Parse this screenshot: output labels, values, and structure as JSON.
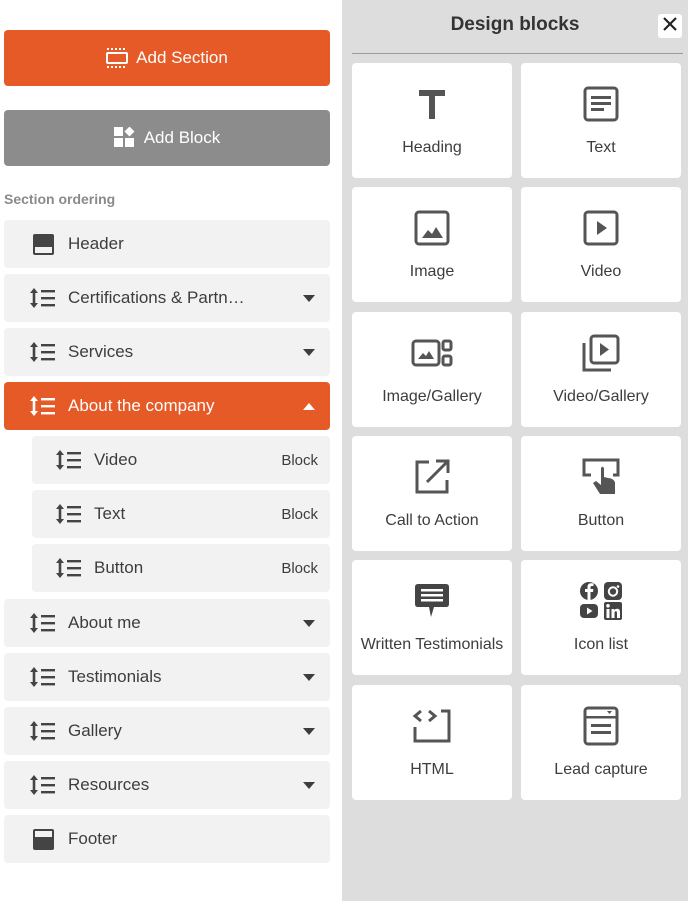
{
  "colors": {
    "accent": "#e55a26",
    "secondary_button": "#8c8c8c",
    "row_bg": "#f2f2f2",
    "icon": "#444444",
    "panel_bg": "#dddddd"
  },
  "left": {
    "add_section_label": "Add Section",
    "add_block_label": "Add Block",
    "section_ordering_label": "Section ordering",
    "rows": [
      {
        "label": "Header",
        "icon": "header-layout-icon",
        "kind": "fixed"
      },
      {
        "label": "Certifications & Partn…",
        "icon": "reorder-icon",
        "kind": "section",
        "expanded": false
      },
      {
        "label": "Services",
        "icon": "reorder-icon",
        "kind": "section",
        "expanded": false
      },
      {
        "label": "About the company",
        "icon": "reorder-icon",
        "kind": "section",
        "expanded": true,
        "active": true
      },
      {
        "label": "Video",
        "icon": "reorder-icon",
        "kind": "block",
        "tag": "Block"
      },
      {
        "label": "Text",
        "icon": "reorder-icon",
        "kind": "block",
        "tag": "Block"
      },
      {
        "label": "Button",
        "icon": "reorder-icon",
        "kind": "block",
        "tag": "Block"
      },
      {
        "label": "About me",
        "icon": "reorder-icon",
        "kind": "section",
        "expanded": false
      },
      {
        "label": "Testimonials",
        "icon": "reorder-icon",
        "kind": "section",
        "expanded": false
      },
      {
        "label": "Gallery",
        "icon": "reorder-icon",
        "kind": "section",
        "expanded": false
      },
      {
        "label": "Resources",
        "icon": "reorder-icon",
        "kind": "section",
        "expanded": false
      },
      {
        "label": "Footer",
        "icon": "footer-layout-icon",
        "kind": "fixed"
      }
    ]
  },
  "right": {
    "title": "Design blocks",
    "close_icon": "close-icon",
    "tiles": [
      {
        "label": "Heading",
        "icon": "heading-icon"
      },
      {
        "label": "Text",
        "icon": "text-icon"
      },
      {
        "label": "Image",
        "icon": "image-icon"
      },
      {
        "label": "Video",
        "icon": "video-icon"
      },
      {
        "label": "Image/Gallery",
        "icon": "image-gallery-icon"
      },
      {
        "label": "Video/Gallery",
        "icon": "video-gallery-icon"
      },
      {
        "label": "Call to Action",
        "icon": "external-link-icon"
      },
      {
        "label": "Button",
        "icon": "button-click-icon"
      },
      {
        "label": "Written Testimonials",
        "icon": "comment-icon"
      },
      {
        "label": "Icon list",
        "icon": "social-icons-icon"
      },
      {
        "label": "HTML",
        "icon": "code-icon"
      },
      {
        "label": "Lead capture",
        "icon": "form-icon"
      }
    ]
  }
}
